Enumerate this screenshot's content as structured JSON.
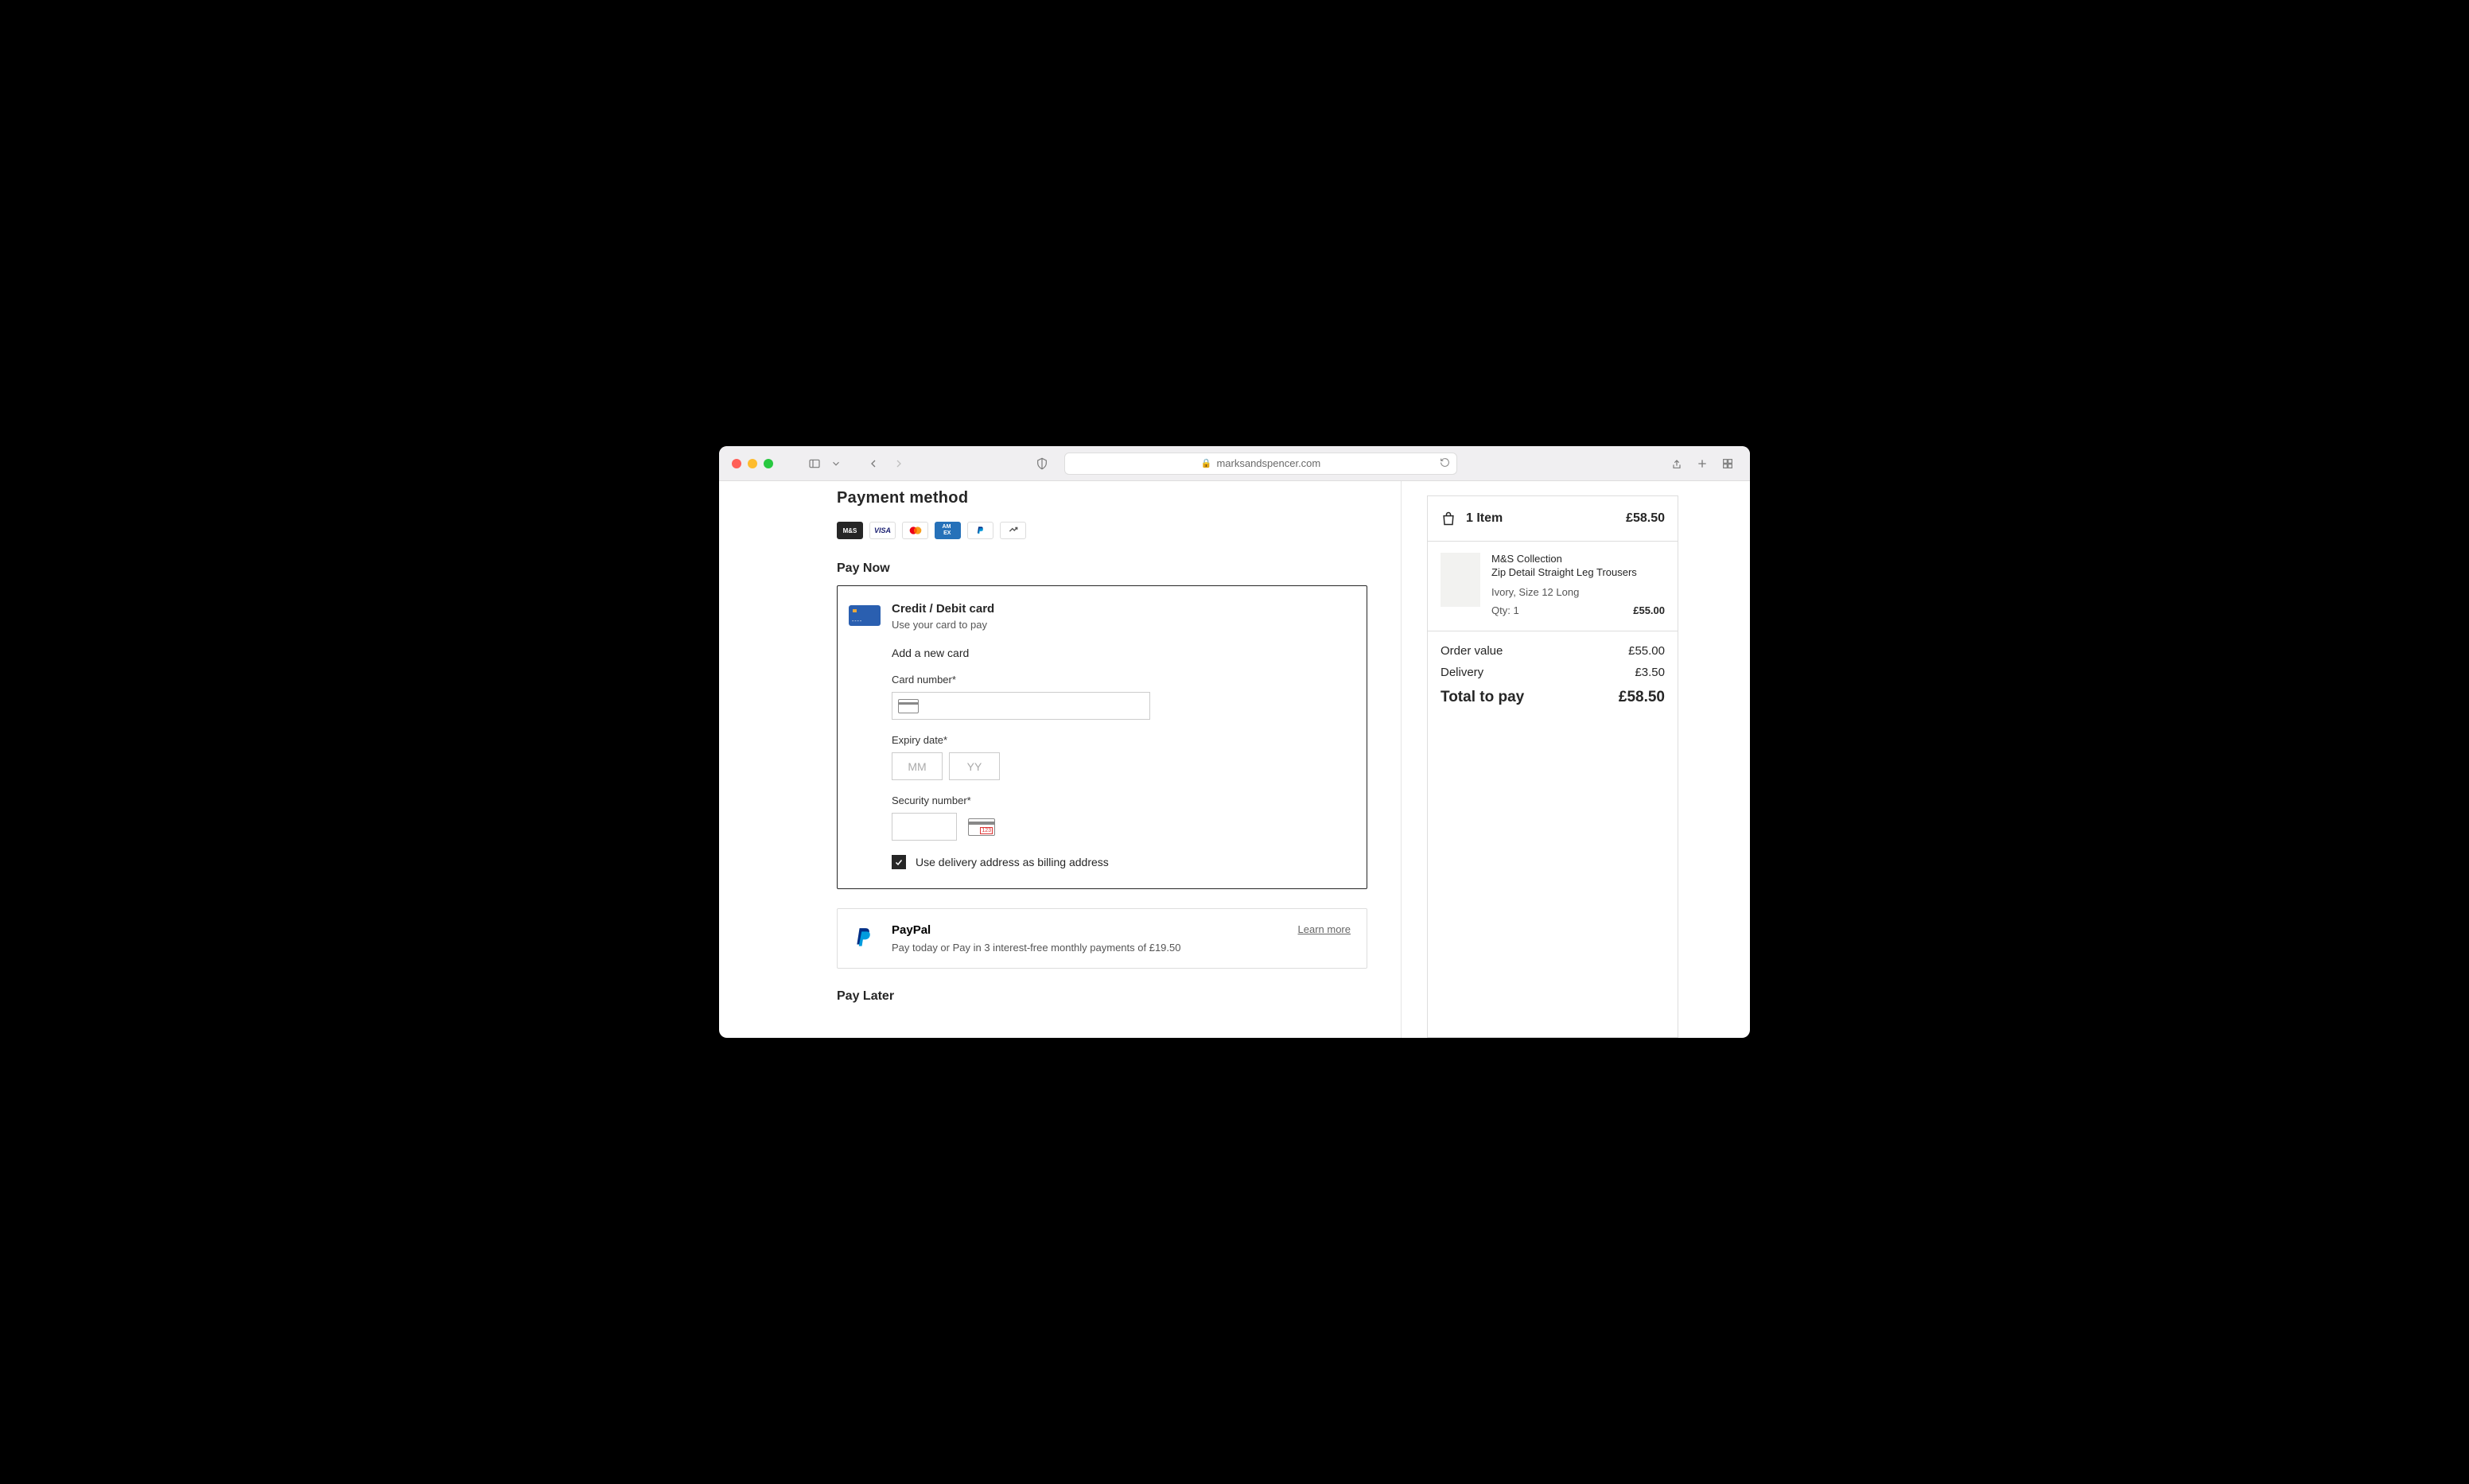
{
  "browser": {
    "url": "marksandspencer.com"
  },
  "payment": {
    "title": "Payment method",
    "methods": [
      "M&S",
      "VISA",
      "mastercard",
      "AMEX",
      "PayPal",
      "Other"
    ],
    "pay_now_title": "Pay Now",
    "card": {
      "title": "Credit / Debit card",
      "subtitle": "Use your card to pay",
      "add_new": "Add a new card",
      "cardnum_label": "Card number*",
      "expiry_label": "Expiry date*",
      "mm_placeholder": "MM",
      "yy_placeholder": "YY",
      "cvv_label": "Security number*",
      "billing_checkbox": "Use delivery address as billing address"
    },
    "paypal": {
      "title": "PayPal",
      "subtitle": "Pay today or Pay in 3 interest-free monthly payments of £19.50",
      "learn_more": "Learn more"
    },
    "pay_later_title": "Pay Later"
  },
  "summary": {
    "item_count_label": "1 Item",
    "top_total": "£58.50",
    "product": {
      "brand": "M&S Collection",
      "name": "Zip Detail Straight Leg Trousers",
      "variant": "Ivory, Size 12 Long",
      "qty": "Qty: 1",
      "price": "£55.00"
    },
    "order_value_label": "Order value",
    "order_value": "£55.00",
    "delivery_label": "Delivery",
    "delivery": "£3.50",
    "total_label": "Total to pay",
    "total": "£58.50"
  }
}
